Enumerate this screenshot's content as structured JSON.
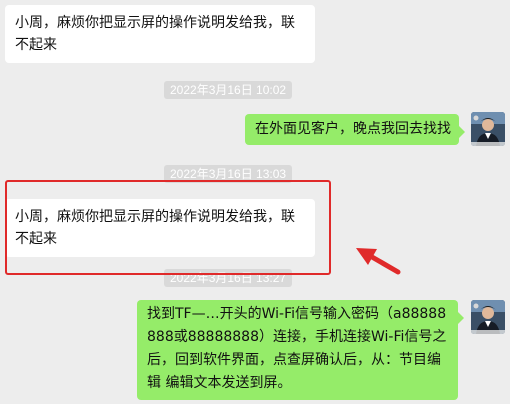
{
  "messages": [
    {
      "text": "小周，麻烦你把显示屏的操作说明发给我，联不起来"
    },
    {
      "text": "在外面见客户，晚点我回去找找"
    },
    {
      "text": "小周，麻烦你把显示屏的操作说明发给我，联不起来"
    },
    {
      "text": "找到TF—…开头的Wi-Fi信号输入密码（a88888888或88888888）连接，手机连接Wi-Fi信号之后，回到软件界面，点查屏确认后，从：节目编辑 编辑文本发送到屏。"
    }
  ],
  "timestamps": [
    "2022年3月16日 10:02",
    "2022年3月16日 13:03",
    "2022年3月16日 13:27"
  ],
  "colors": {
    "background": "#ededed",
    "bubble_in": "#ffffff",
    "bubble_out": "#95ec69",
    "annotation": "#e02a2a"
  }
}
